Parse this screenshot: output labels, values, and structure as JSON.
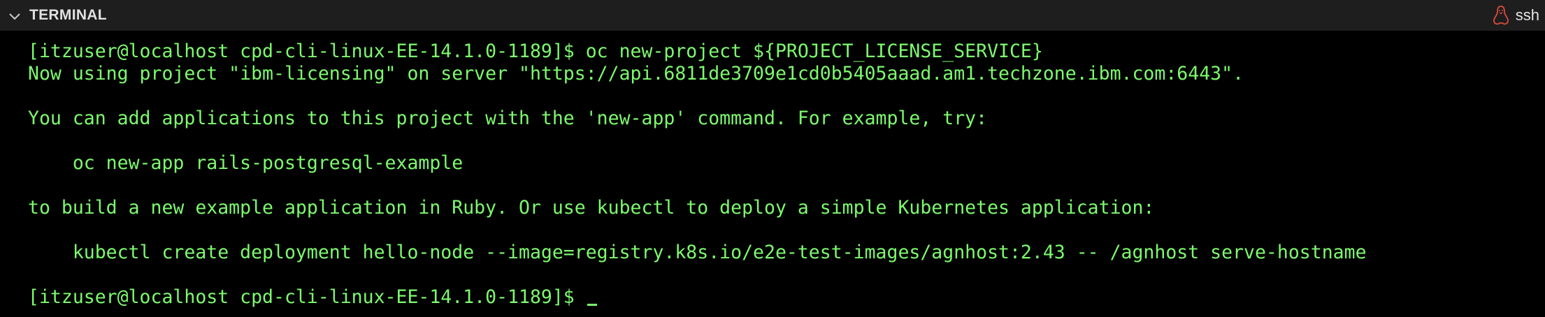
{
  "panel": {
    "title": "TERMINAL",
    "shell_name": "ssh",
    "icons": {
      "collapse": "chevron-down-icon",
      "shell": "linux-icon"
    },
    "colors": {
      "background": "#000000",
      "titlebar": "#1e1e1e",
      "text": "#7dfa6e",
      "shell_icon": "#e04b3c"
    }
  },
  "terminal": {
    "lines": [
      "[itzuser@localhost cpd-cli-linux-EE-14.1.0-1189]$ oc new-project ${PROJECT_LICENSE_SERVICE}",
      "Now using project \"ibm-licensing\" on server \"https://api.6811de3709e1cd0b5405aaad.am1.techzone.ibm.com:6443\".",
      "",
      "You can add applications to this project with the 'new-app' command. For example, try:",
      "",
      "    oc new-app rails-postgresql-example",
      "",
      "to build a new example application in Ruby. Or use kubectl to deploy a simple Kubernetes application:",
      "",
      "    kubectl create deployment hello-node --image=registry.k8s.io/e2e-test-images/agnhost:2.43 -- /agnhost serve-hostname",
      "",
      "[itzuser@localhost cpd-cli-linux-EE-14.1.0-1189]$ "
    ]
  }
}
